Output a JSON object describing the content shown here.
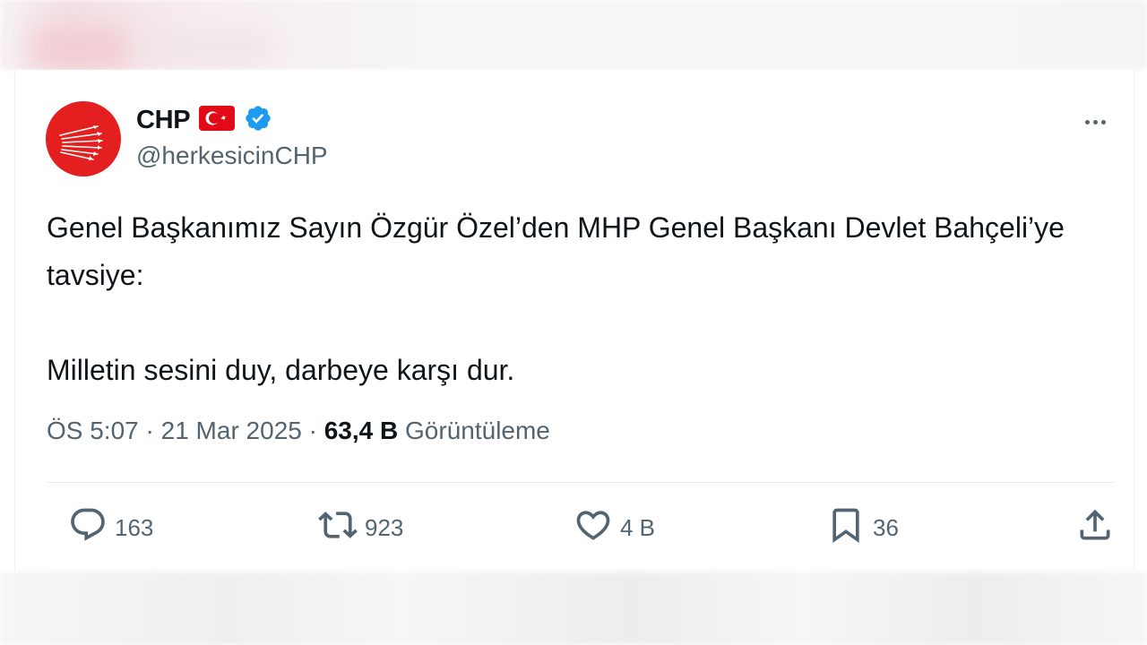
{
  "tweet": {
    "author_name": "CHP",
    "author_handle": "@herkesicinCHP",
    "text_paragraph_1": "Genel Başkanımız Sayın Özgür Özel’den MHP Genel Başkanı Devlet Bahçeli’ye tavsiye:",
    "text_paragraph_2": "Milletin sesini duy, darbeye karşı dur.",
    "time": "ÖS 5:07",
    "separator": "·",
    "date": "21 Mar 2025",
    "views_count": "63,4 B",
    "views_label": "Görüntüleme"
  },
  "actions": {
    "replies": "163",
    "retweets": "923",
    "likes": "4 B",
    "bookmarks": "36"
  },
  "icons": {
    "avatar": "chp-six-arrows-logo",
    "flag": "turkey-flag-icon",
    "verified": "verified-badge-icon",
    "more": "more-options-icon",
    "reply": "reply-icon",
    "retweet": "retweet-icon",
    "like": "heart-icon",
    "bookmark": "bookmark-icon",
    "share": "share-icon"
  },
  "colors": {
    "text_primary": "#0f1419",
    "text_secondary": "#536471",
    "verified_blue": "#1d9bf0",
    "brand_red": "#e3201f"
  }
}
